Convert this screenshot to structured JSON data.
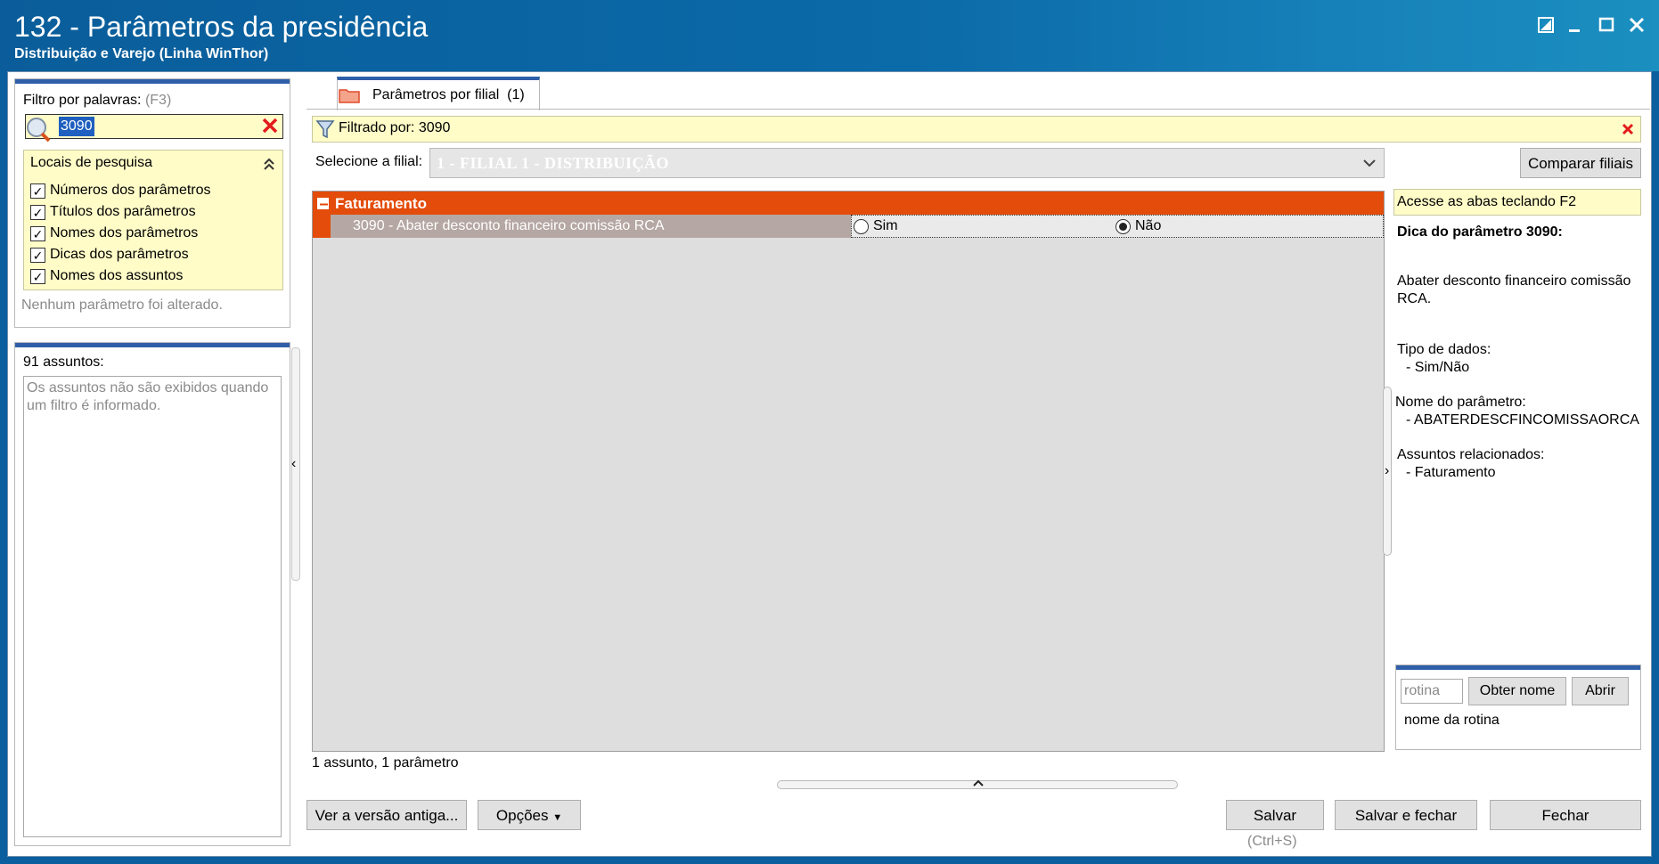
{
  "window": {
    "title": "132 - Parâmetros da presidência",
    "subtitle": "Distribuição e Varejo (Linha WinThor)"
  },
  "filter": {
    "label": "Filtro por palavras:",
    "shortcut": "(F3)",
    "value": "3090",
    "search_locations_title": "Locais de pesquisa",
    "options": [
      {
        "label": "Números dos parâmetros",
        "checked": true
      },
      {
        "label": "Títulos dos parâmetros",
        "checked": true
      },
      {
        "label": "Nomes dos parâmetros",
        "checked": true
      },
      {
        "label": "Dicas dos parâmetros",
        "checked": true
      },
      {
        "label": "Nomes dos assuntos",
        "checked": true
      }
    ],
    "status": "Nenhum parâmetro foi alterado."
  },
  "subjects": {
    "count_label": "91 assuntos:",
    "info": "Os assuntos não são exibidos quando um filtro é informado."
  },
  "tab": {
    "label": "Parâmetros por filial",
    "count": "(1)"
  },
  "filter_bar": {
    "text": "Filtrado por: 3090"
  },
  "branch": {
    "label": "Selecione a filial:",
    "value": "1 - FILIAL 1 - DISTRIBUIÇÃO",
    "compare_button": "Comparar filiais"
  },
  "grid": {
    "group": "Faturamento",
    "row": {
      "label": "3090 - Abater desconto financeiro comissão RCA",
      "option_yes": "Sim",
      "option_no": "Não",
      "selected": "Não"
    },
    "summary": "1 assunto, 1 parâmetro"
  },
  "tips": {
    "hint": "Acesse as abas teclando F2",
    "heading": "Dica do parâmetro 3090:",
    "description": "Abater desconto financeiro comissão RCA.",
    "data_type_label": "Tipo de dados:",
    "data_type_value": "- Sim/Não",
    "param_name_label": "Nome do parâmetro:",
    "param_name_value": "- ABATERDESCFINCOMISSAORCA",
    "subjects_label": "Assuntos relacionados:",
    "subjects_value": "- Faturamento"
  },
  "routine": {
    "placeholder": "rotina",
    "get_name_button": "Obter nome",
    "open_button": "Abrir",
    "name_label": "nome da rotina"
  },
  "footer": {
    "old_version_button": "Ver a versão antiga...",
    "options_button": "Opções",
    "save_button": "Salvar",
    "save_shortcut": "(Ctrl+S)",
    "save_close_button": "Salvar e fechar",
    "close_button": "Fechar"
  },
  "colors": {
    "group_header": "#e34c0a",
    "row_highlight": "#b5a7a3",
    "accent_blue": "#2f5fa8",
    "yellow": "#fffcc8"
  }
}
